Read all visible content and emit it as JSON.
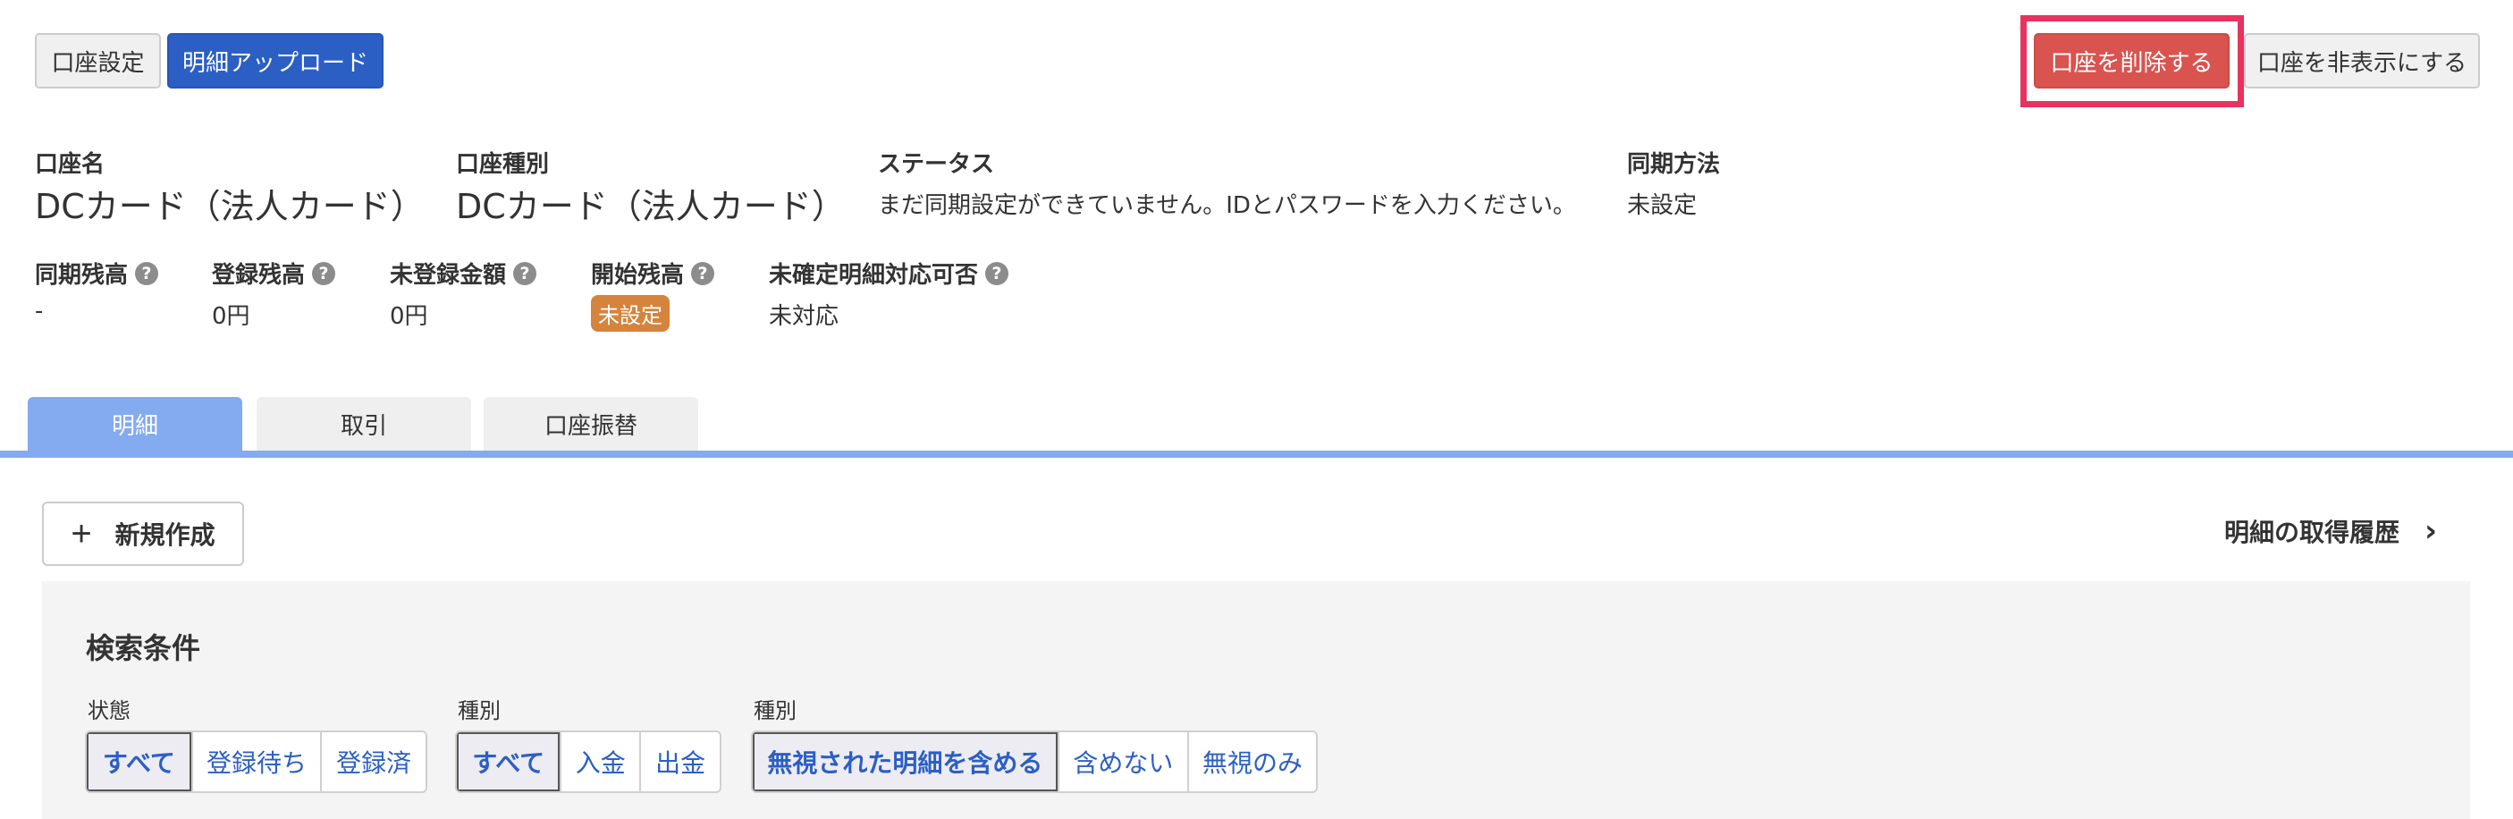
{
  "toolbar": {
    "account_settings": "口座設定",
    "upload_details": "明細アップロード",
    "delete_account": "口座を削除する",
    "hide_account": "口座を非表示にする"
  },
  "account_info": {
    "name_label": "口座名",
    "name_value": "DCカード（法人カード）",
    "type_label": "口座種別",
    "type_value": "DCカード（法人カード）",
    "status_label": "ステータス",
    "status_value": "まだ同期設定ができていません。IDとパスワードを入力ください。",
    "sync_method_label": "同期方法",
    "sync_method_value": "未設定"
  },
  "balances": {
    "sync_balance_label": "同期残高",
    "sync_balance_value": "-",
    "registered_balance_label": "登録残高",
    "registered_balance_value": "0円",
    "unregistered_amount_label": "未登録金額",
    "unregistered_amount_value": "0円",
    "opening_balance_label": "開始残高",
    "opening_balance_badge": "未設定",
    "unconfirmed_label": "未確定明細対応可否",
    "unconfirmed_value": "未対応",
    "help_glyph": "?"
  },
  "tabs": [
    {
      "label": "明細",
      "active": true
    },
    {
      "label": "取引",
      "active": false
    },
    {
      "label": "口座振替",
      "active": false
    }
  ],
  "actions": {
    "new_button": "新規作成",
    "plus_glyph": "+",
    "history_link": "明細の取得履歴",
    "chevron_glyph": "›"
  },
  "search": {
    "title": "検索条件",
    "groups": [
      {
        "label": "状態",
        "options": [
          "すべて",
          "登録待ち",
          "登録済"
        ],
        "selected": 0
      },
      {
        "label": "種別",
        "options": [
          "すべて",
          "入金",
          "出金"
        ],
        "selected": 0
      },
      {
        "label": "種別",
        "options": [
          "無視された明細を含める",
          "含めない",
          "無視のみ"
        ],
        "selected": 0
      }
    ]
  },
  "colors": {
    "primary_blue": "#2c5fc4",
    "danger_red": "#d9534f",
    "tab_active": "#84aaf0",
    "badge_orange": "#d4843c",
    "highlight_pink": "#e8335f"
  }
}
